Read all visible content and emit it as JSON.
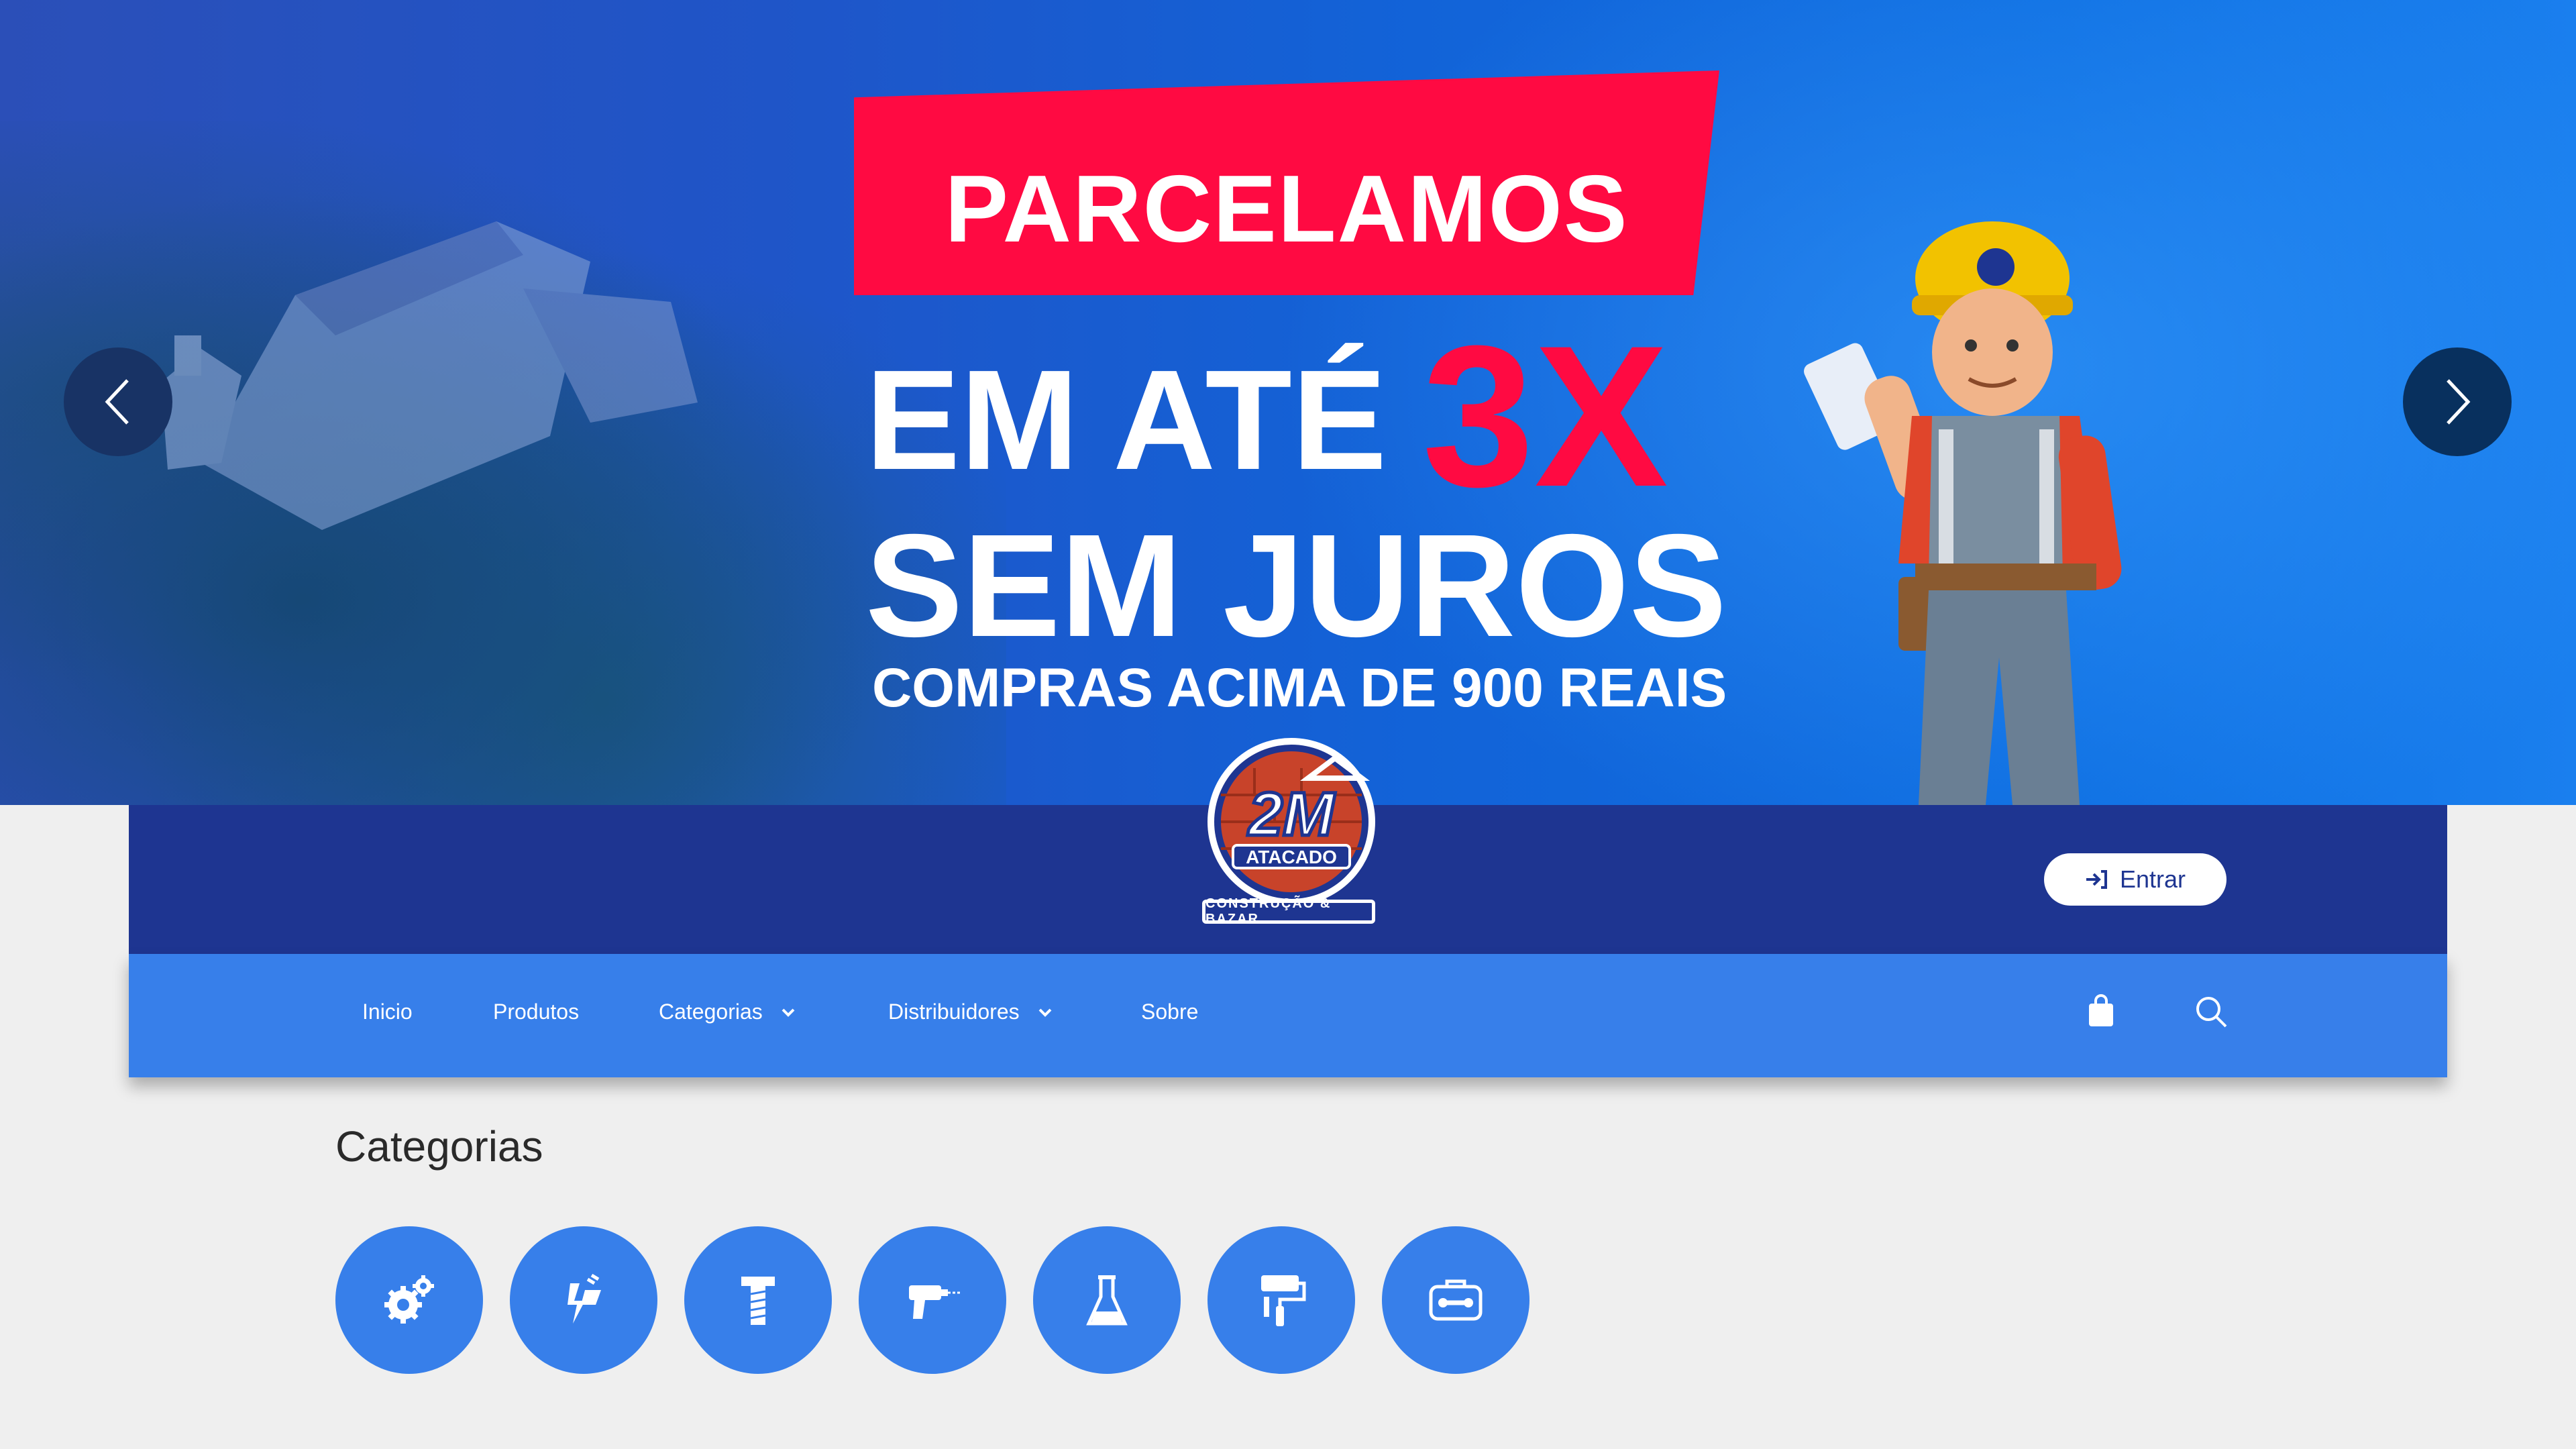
{
  "banner": {
    "ribbon": "PARCELAMOS",
    "line1": "EM ATÉ",
    "accent": "3X",
    "line2": "SEM JUROS",
    "line3": "COMPRAS ACIMA DE 900 REAIS",
    "ribbon_color": "#ff0a42"
  },
  "logo": {
    "mark": "2M",
    "name": "ATACADO",
    "tagline": "CONSTRUÇÃO & BAZAR"
  },
  "header": {
    "login_label": "Entrar"
  },
  "nav": {
    "items": [
      {
        "label": "Inicio"
      },
      {
        "label": "Produtos"
      },
      {
        "label": "Categorias"
      },
      {
        "label": "Distribuidores"
      },
      {
        "label": "Sobre"
      }
    ],
    "icons": [
      "bag-icon",
      "search-icon"
    ]
  },
  "categories": {
    "title": "Categorias",
    "items": [
      {
        "icon": "gears-icon"
      },
      {
        "icon": "electric-plug-icon"
      },
      {
        "icon": "screw-icon"
      },
      {
        "icon": "drill-icon"
      },
      {
        "icon": "flask-icon"
      },
      {
        "icon": "paint-roller-icon"
      },
      {
        "icon": "toolbox-icon"
      }
    ]
  },
  "colors": {
    "header": "#1e3591",
    "nav": "#377fea",
    "accent": "#ff0a42",
    "background": "#efefef"
  }
}
